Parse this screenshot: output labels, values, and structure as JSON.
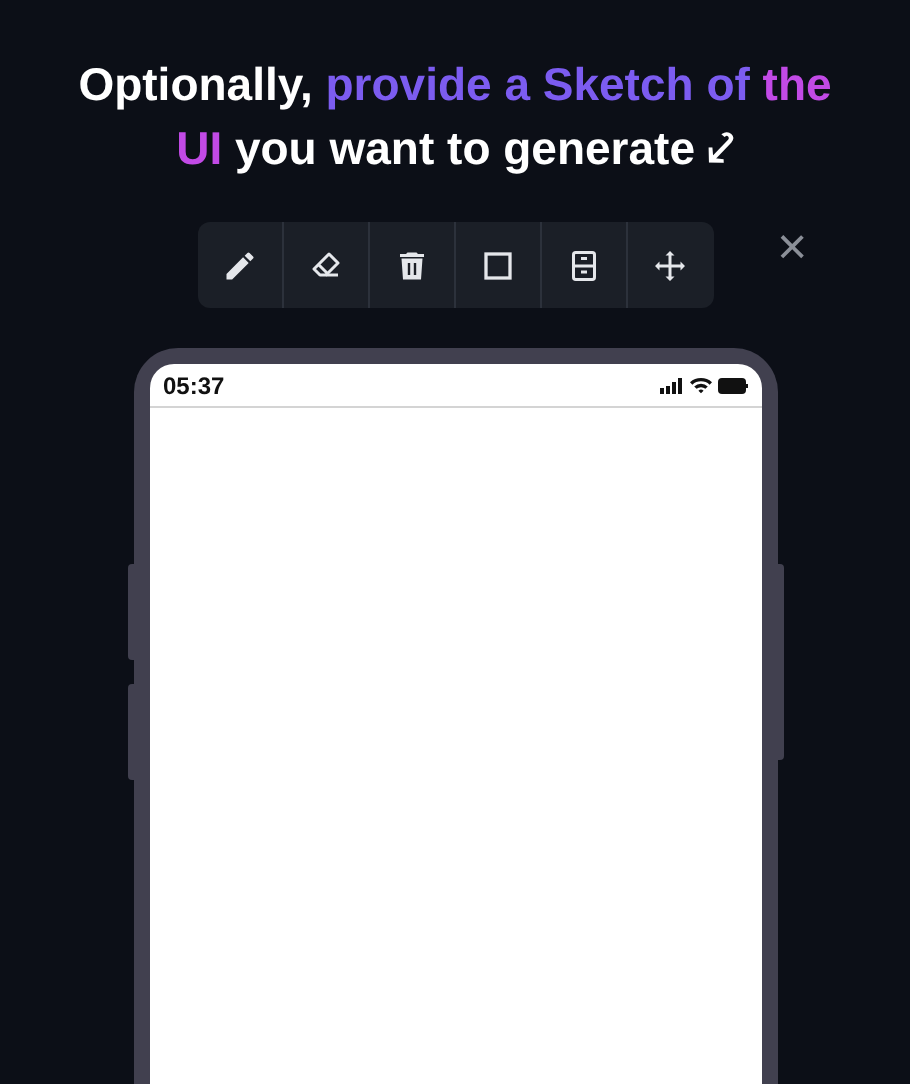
{
  "heading": [
    {
      "text": "Optionally, ",
      "color": "#ffffff"
    },
    {
      "text": "provide a Sketch of ",
      "color": "#7c5cf0"
    },
    {
      "text": "the UI",
      "color": "#c24ae6"
    },
    {
      "text": " you want to generate ⤦",
      "color": "#ffffff"
    }
  ],
  "toolbar": [
    {
      "kind": "pencil"
    },
    {
      "kind": "eraser"
    },
    {
      "kind": "trash"
    },
    {
      "kind": "square"
    },
    {
      "kind": "cabinet"
    },
    {
      "kind": "move"
    }
  ],
  "close": "×",
  "phone": {
    "status_time": "05:37"
  }
}
